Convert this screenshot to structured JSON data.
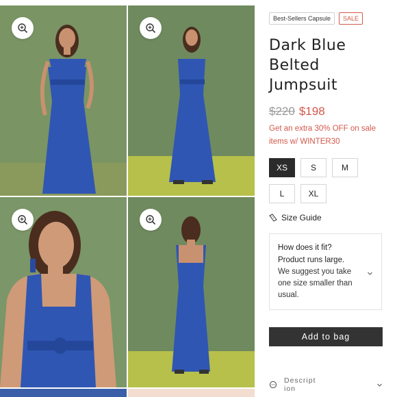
{
  "gallery": {
    "images": [
      {
        "alt": "model-front-pose",
        "zoom_icon": "zoom-in-icon"
      },
      {
        "alt": "model-front-full",
        "zoom_icon": "zoom-in-icon"
      },
      {
        "alt": "model-closeup-smiling",
        "zoom_icon": "zoom-in-icon"
      },
      {
        "alt": "model-back-view",
        "zoom_icon": "zoom-in-icon"
      }
    ],
    "colors": {
      "wall": "#6f8a5f",
      "floor": "#b7c04a",
      "dress": "#2f56b3"
    }
  },
  "product": {
    "tags": {
      "collection": "Best-Sellers Capsule",
      "sale": "SALE"
    },
    "title": "Dark Blue Belted Jumpsuit",
    "price_old": "$220",
    "price_new": "$198",
    "promo": "Get an extra 30% OFF on sale items w/ WINTER30",
    "sizes": [
      "XS",
      "S",
      "M",
      "L",
      "XL"
    ],
    "selected_size": "XS",
    "size_guide": "Size Guide",
    "fit": {
      "question": "How does it fit?",
      "answer": "Product runs large.",
      "suggestion": "We suggest you take one size smaller than usual."
    },
    "add_to_bag": "Add to bag",
    "description_label": "Description"
  },
  "colors": {
    "sale_accent": "#d2584b",
    "button_dark": "#333333"
  }
}
